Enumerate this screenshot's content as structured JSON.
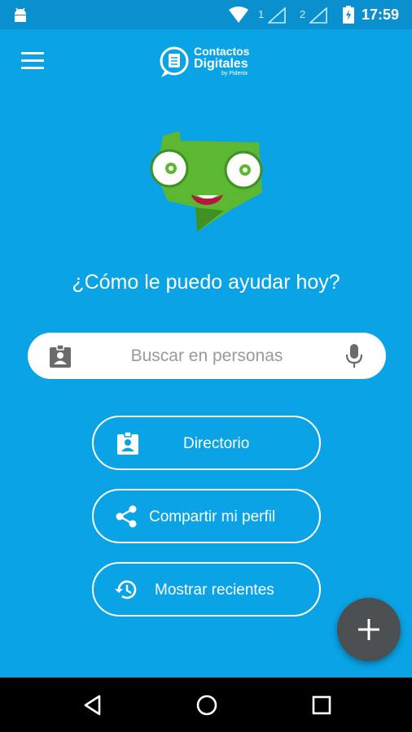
{
  "status_bar": {
    "sim1_label": "1",
    "sim2_label": "2",
    "time": "17:59"
  },
  "app_bar": {
    "logo_line1": "Contactos",
    "logo_line2": "Digitales",
    "logo_by": "by Pidenix"
  },
  "main": {
    "greeting": "¿Cómo le puedo ayudar hoy?",
    "search": {
      "placeholder": "Buscar en personas"
    },
    "actions": {
      "directorio": "Directorio",
      "compartir": "Compartir mi perfil",
      "recientes": "Mostrar recientes"
    }
  },
  "icons": {
    "menu": "hamburger-menu-icon",
    "search_left": "contact-card-icon",
    "search_right": "microphone-icon",
    "directorio": "contact-card-icon",
    "compartir": "share-icon",
    "recientes": "history-icon",
    "fab": "plus-icon",
    "nav": [
      "back-icon",
      "home-icon",
      "recents-icon"
    ]
  },
  "colors": {
    "background": "#0aa3e6",
    "status_bar": "#0a8fcf",
    "fab": "#4c4f52",
    "mascot_green": "#5cb832"
  }
}
